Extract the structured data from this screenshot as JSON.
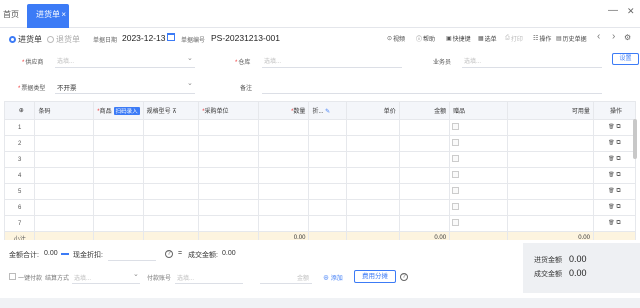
{
  "tabs": {
    "home": "首页",
    "active": "进货单",
    "close": "×"
  },
  "window": {
    "minimize": "—",
    "close": "✕"
  },
  "toolbar": {
    "radio_in": "进货单",
    "radio_return": "退货单",
    "date_label": "单据日期",
    "date_value": "2023-12-13",
    "code_label": "单据编号",
    "code_value": "PS-20231213-001",
    "actions": [
      "视频",
      "帮助",
      "快捷键",
      "选单",
      "打印",
      "操作",
      "历史单据"
    ],
    "nav_prev": "‹",
    "nav_next": "›"
  },
  "form": {
    "supplier_label": "供应商",
    "supplier_placeholder": "选填...",
    "warehouse_label": "仓库",
    "warehouse_placeholder": "选填...",
    "salesman_label": "业务员",
    "salesman_placeholder": "选填...",
    "settings_button": "设置",
    "invoice_label": "票据类型",
    "invoice_value": "不开票",
    "remark_label": "备注"
  },
  "table": {
    "headers": [
      "条码",
      "商品",
      "规格型号",
      "采购单位",
      "数量",
      "折...",
      "单价",
      "金额",
      "赠品",
      "可用量",
      "操作"
    ],
    "scan_button": "扫码录入",
    "rows": [
      "1",
      "2",
      "3",
      "4",
      "5",
      "6",
      "7"
    ],
    "subtotal_label": "小计",
    "subtotal_qty": "0.00",
    "subtotal_amount": "0.00",
    "subtotal_available": "0.00"
  },
  "bottom": {
    "amount_total_label": "金额合计:",
    "amount_total_value": "0.00",
    "cash_discount_label": "现金折扣:",
    "deal_amount_label": "成交金额:",
    "deal_amount_value": "0.00",
    "one_click_pay": "一键付款",
    "settle_method_label": "结算方式",
    "settle_method_placeholder": "选填...",
    "pay_account_label": "付款账号",
    "pay_account_placeholder": "选填...",
    "amount_placeholder": "金额",
    "add_label": "添加",
    "fee_button": "费用分摊"
  },
  "summary": {
    "in_amount_label": "进货金额",
    "in_amount_value": "0.00",
    "deal_amount_label": "成交金额",
    "deal_amount_value": "0.00"
  },
  "colors": {
    "accent": "#3c7bf6",
    "subtotal_bg": "#fdf4df",
    "required": "#e33333"
  }
}
